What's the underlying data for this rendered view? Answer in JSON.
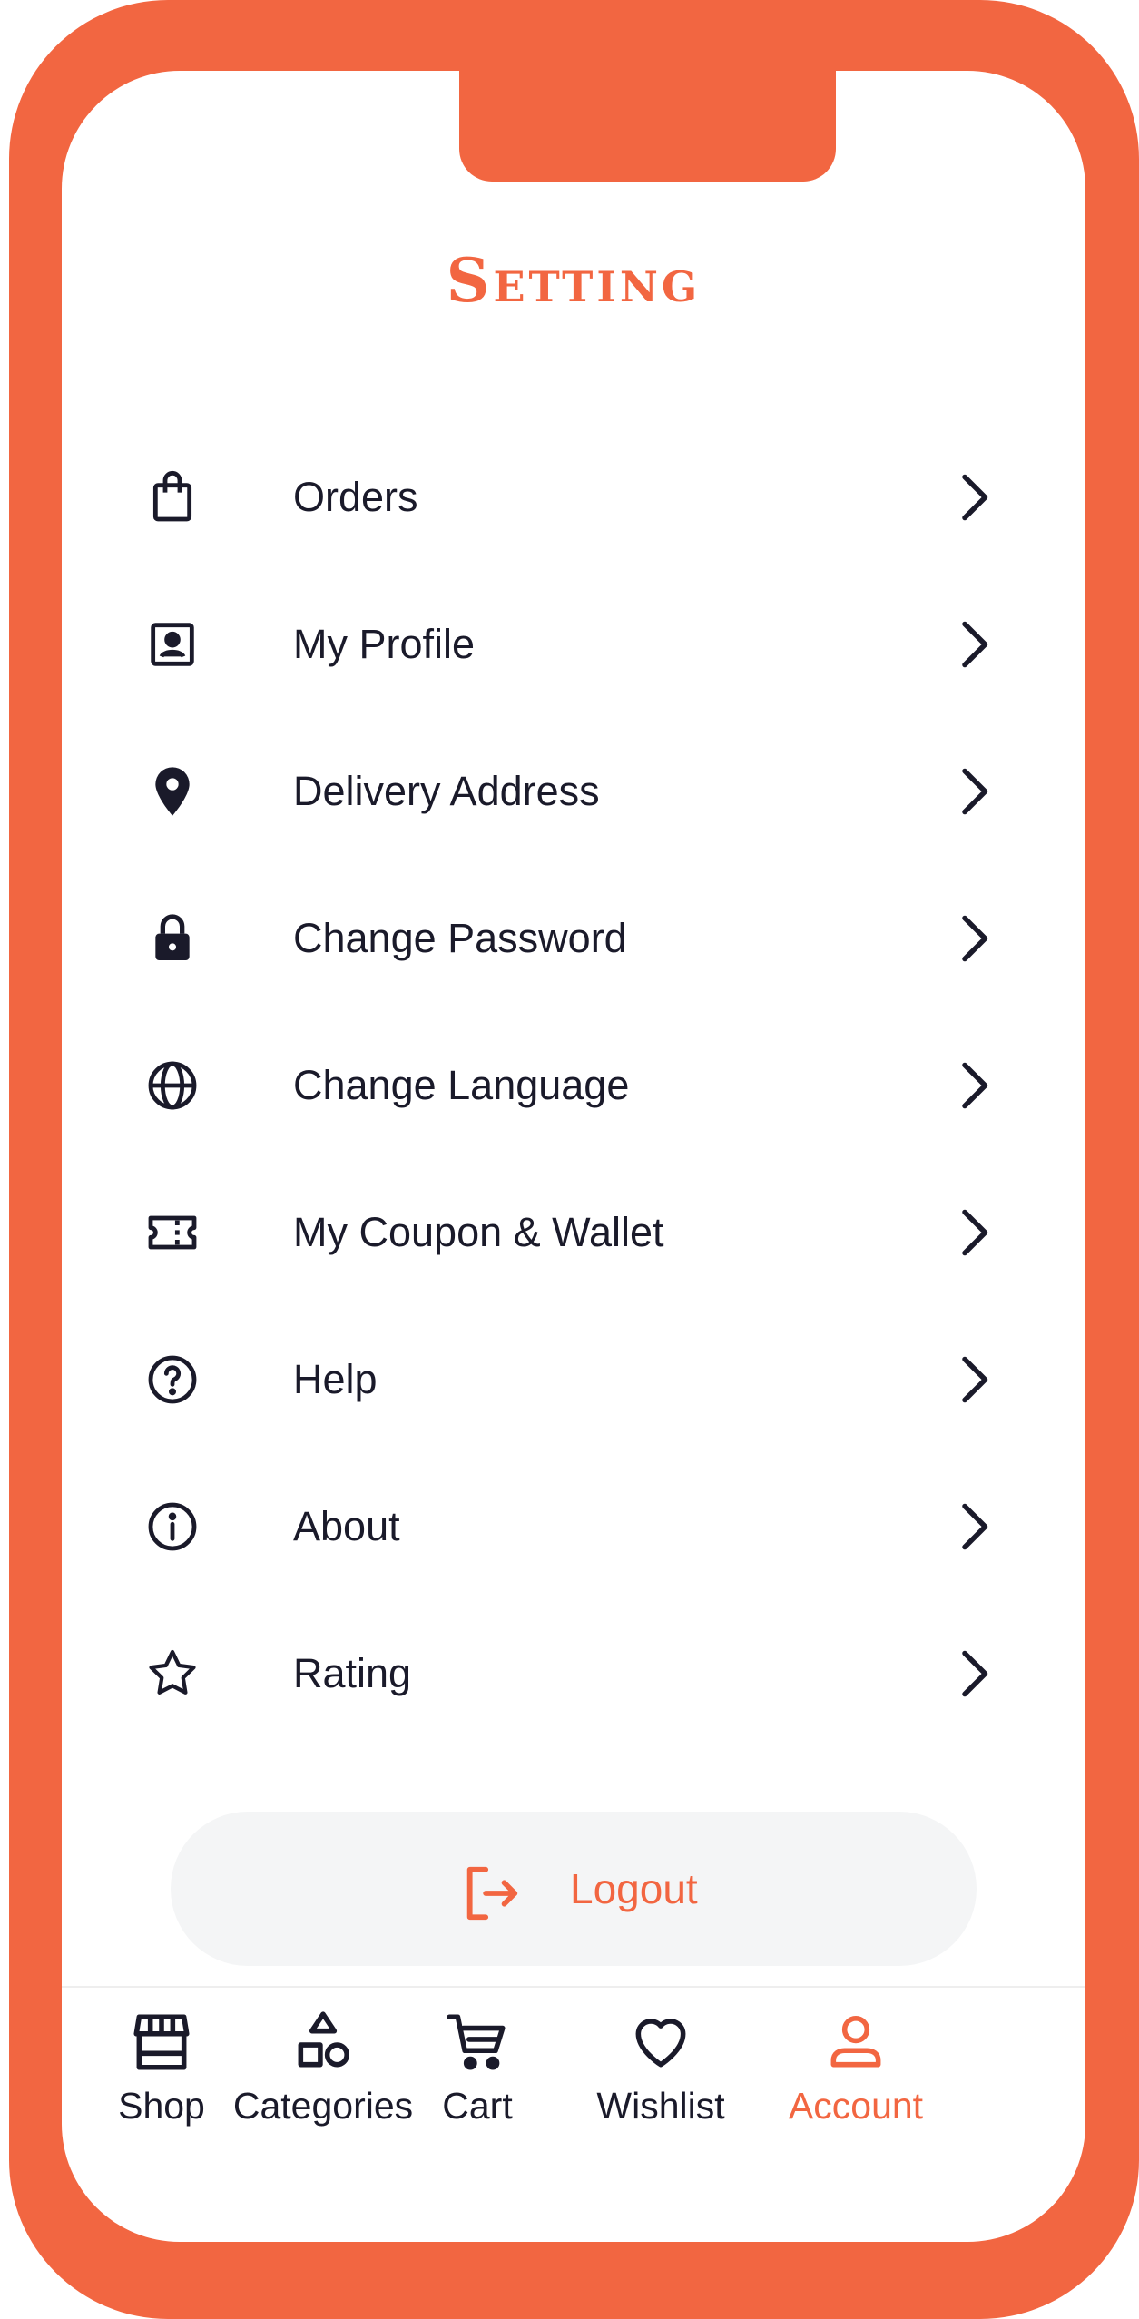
{
  "header": {
    "title": "Setting"
  },
  "menu": {
    "items": [
      {
        "label": "Orders",
        "icon": "shopping-bag-icon"
      },
      {
        "label": "My Profile",
        "icon": "profile-card-icon"
      },
      {
        "label": "Delivery Address",
        "icon": "location-pin-icon"
      },
      {
        "label": "Change Password",
        "icon": "lock-icon"
      },
      {
        "label": "Change Language",
        "icon": "globe-icon"
      },
      {
        "label": "My Coupon & Wallet",
        "icon": "ticket-icon"
      },
      {
        "label": "Help",
        "icon": "help-circle-icon"
      },
      {
        "label": "About",
        "icon": "info-circle-icon"
      },
      {
        "label": "Rating",
        "icon": "star-icon"
      }
    ]
  },
  "logout": {
    "label": "Logout",
    "icon": "logout-icon"
  },
  "bottom_nav": {
    "items": [
      {
        "label": "Shop",
        "icon": "store-icon"
      },
      {
        "label": "Categories",
        "icon": "shapes-icon"
      },
      {
        "label": "Cart",
        "icon": "cart-icon"
      },
      {
        "label": "Wishlist",
        "icon": "heart-icon"
      },
      {
        "label": "Account",
        "icon": "user-icon"
      }
    ],
    "active": "Account"
  },
  "colors": {
    "accent": "#f26641",
    "text": "#1a1a2a",
    "button_bg": "#f4f5f6"
  }
}
